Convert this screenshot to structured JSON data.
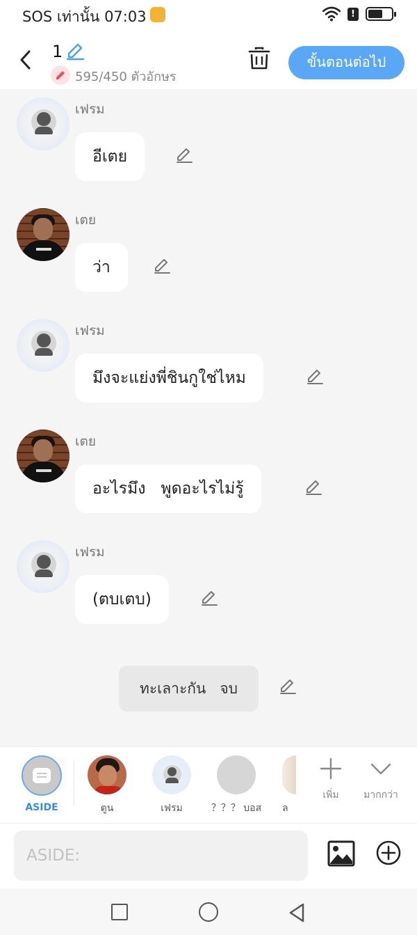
{
  "status_bar": {
    "carrier_text": "SOS เท่านั้น 07:03",
    "battery_level": 0.55
  },
  "header": {
    "title": "1",
    "char_count": "595/450 ตัวอักษร",
    "next_label": "ขั้นตอนต่อไป"
  },
  "messages": [
    {
      "speaker": "เฟรม",
      "text": "อีเตย",
      "avatar": "default-avatar"
    },
    {
      "speaker": "เตย",
      "text": "ว่า",
      "avatar": "photo-avatar"
    },
    {
      "speaker": "เฟรม",
      "text": "มึงจะแย่งพี่ชินกูใช่ไหม",
      "avatar": "default-avatar"
    },
    {
      "speaker": "เตย",
      "text": "อะไรมึง   พูดอะไรไม่รู้",
      "avatar": "photo-avatar"
    },
    {
      "speaker": "เฟรม",
      "text": "(ตบเตบ)",
      "avatar": "default-avatar"
    }
  ],
  "narration": {
    "text": "ทะเลาะกัน   จบ"
  },
  "character_bar": {
    "aside_label": "ASIDE",
    "characters": [
      {
        "label": "ตูน"
      },
      {
        "label": "เฟรม"
      },
      {
        "label": "？？？ บอส"
      },
      {
        "label": "ล"
      }
    ],
    "add_label": "เพิ่ม",
    "more_label": "มากกว่า"
  },
  "input": {
    "placeholder": "ASIDE:"
  },
  "colors": {
    "accent": "#5aa7f5",
    "aside_accent": "#3b8ce0",
    "background": "#f5f5f5"
  }
}
